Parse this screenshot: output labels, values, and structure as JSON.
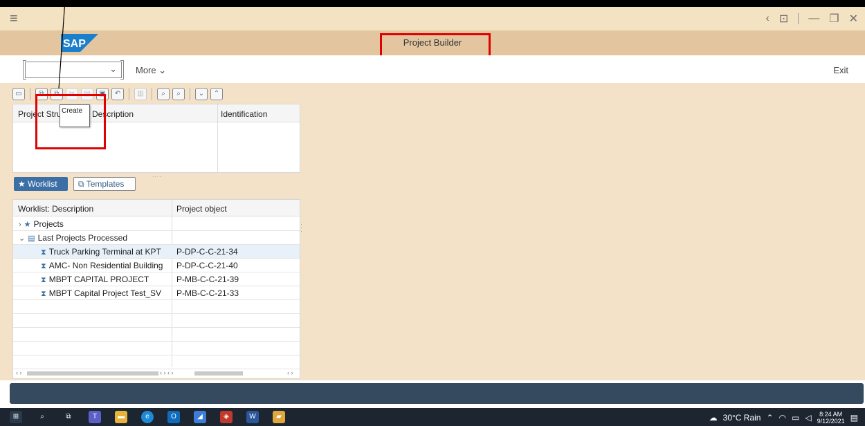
{
  "system_bar": {
    "menu_icon": "hamburger-icon",
    "controls": [
      "back-icon",
      "lock-icon",
      "minimize-icon",
      "restore-icon",
      "close-icon"
    ]
  },
  "header": {
    "logo_text": "SAP",
    "title": "Project Builder",
    "brand_color": "#1b7fcc"
  },
  "toolbar": {
    "command_value": "",
    "more_label": "More",
    "exit_label": "Exit"
  },
  "structure": {
    "toolbar_icons": [
      "open-icon",
      "create-icon",
      "delete-icon",
      "copy-icon",
      "paste-icon",
      "undo-icon",
      "trash-icon",
      "find-icon",
      "find-next-icon",
      "expand-icon",
      "collapse-icon"
    ],
    "columns": [
      "Project Struc",
      "Description",
      "Identification"
    ],
    "tooltip": "Create"
  },
  "tabs": {
    "worklist": "Worklist",
    "templates": "Templates"
  },
  "worklist": {
    "columns": [
      "Worklist: Description",
      "Project object"
    ],
    "rows": [
      {
        "desc": "Projects",
        "obj": ""
      },
      {
        "desc": "Last Projects Processed",
        "obj": ""
      },
      {
        "desc": "Truck Parking Terminal at KPT",
        "obj": "P-DP-C-C-21-34"
      },
      {
        "desc": "AMC- Non Residential Building",
        "obj": "P-DP-C-C-21-40"
      },
      {
        "desc": "MBPT CAPITAL PROJECT",
        "obj": "P-MB-C-C-21-39"
      },
      {
        "desc": "MBPT Capital Project Test_SV",
        "obj": "P-MB-C-C-21-33"
      }
    ]
  },
  "tray": {
    "weather": "30°C  Rain",
    "time": "8:24 AM",
    "date": "9/12/2021"
  }
}
